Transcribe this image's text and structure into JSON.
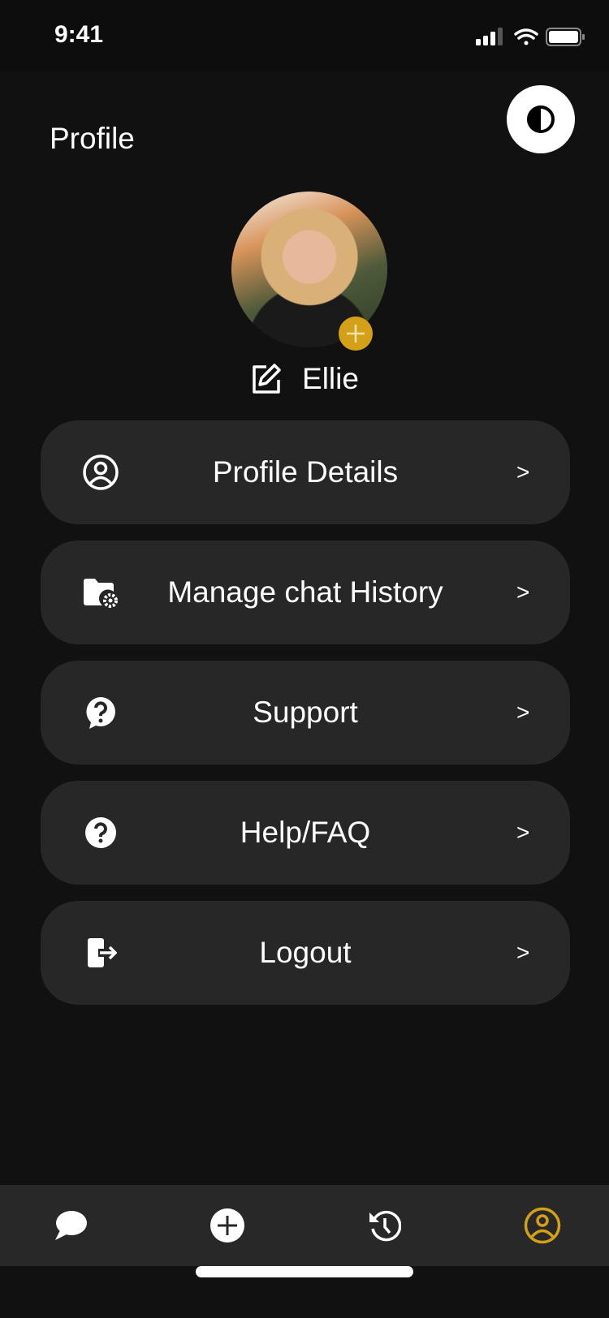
{
  "status_bar": {
    "time": "9:41",
    "icons": [
      "signal-icon",
      "wifi-icon",
      "battery-icon"
    ]
  },
  "header": {
    "title": "Profile",
    "theme_toggle_icon": "contrast-icon"
  },
  "profile": {
    "name": "Ellie",
    "avatar_badge_icon": "plus-icon",
    "edit_icon": "edit-icon"
  },
  "menu": [
    {
      "label": "Profile Details",
      "icon": "user-circle-icon",
      "chevron": ">"
    },
    {
      "label": "Manage chat History",
      "icon": "folder-settings-icon",
      "chevron": ">"
    },
    {
      "label": "Support",
      "icon": "question-bubble-icon",
      "chevron": ">"
    },
    {
      "label": "Help/FAQ",
      "icon": "question-circle-icon",
      "chevron": ">"
    },
    {
      "label": "Logout",
      "icon": "logout-icon",
      "chevron": ">"
    }
  ],
  "bottom_nav": [
    {
      "icon": "chat-icon",
      "active": false
    },
    {
      "icon": "add-circle-icon",
      "active": false
    },
    {
      "icon": "history-icon",
      "active": false
    },
    {
      "icon": "profile-icon",
      "active": true
    }
  ],
  "colors": {
    "accent": "#d4a017",
    "background": "#111111",
    "card": "#272727",
    "nav": "#282828"
  }
}
